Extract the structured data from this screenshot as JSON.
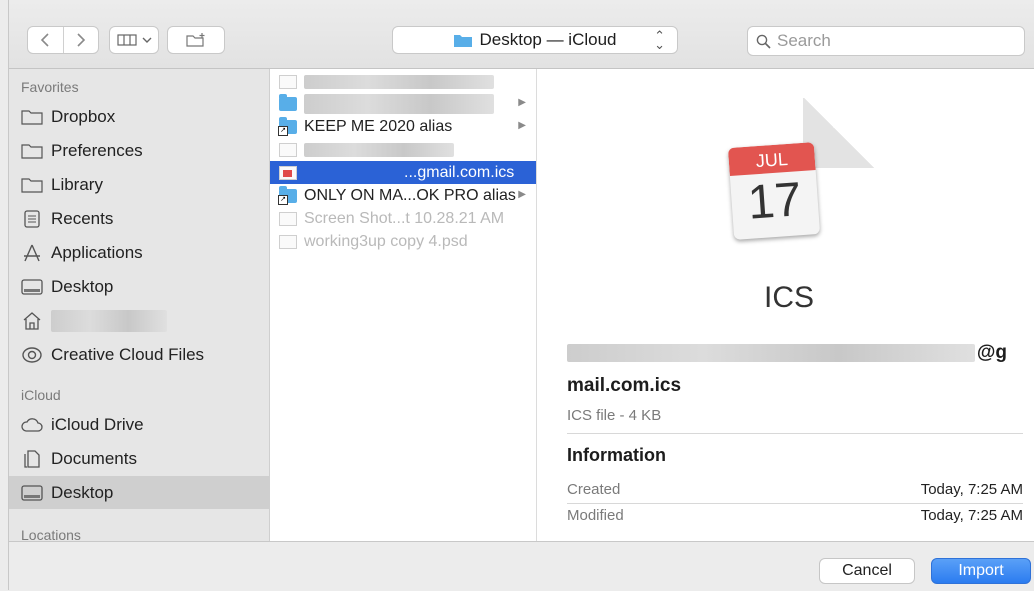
{
  "toolbar": {
    "back_icon": "chevron-left-icon",
    "forward_icon": "chevron-right-icon",
    "view_icon": "columns-view-icon",
    "new_folder_icon": "new-folder-icon",
    "location": "Desktop — iCloud",
    "search_placeholder": "Search"
  },
  "sidebar": {
    "favorites_heading": "Favorites",
    "favorites": [
      {
        "label": "Dropbox",
        "icon": "folder-icon"
      },
      {
        "label": "Preferences",
        "icon": "folder-icon"
      },
      {
        "label": "Library",
        "icon": "folder-icon"
      },
      {
        "label": "Recents",
        "icon": "recents-icon"
      },
      {
        "label": "Applications",
        "icon": "applications-icon"
      },
      {
        "label": "Desktop",
        "icon": "desktop-icon"
      },
      {
        "label": "",
        "icon": "home-icon"
      },
      {
        "label": "Creative Cloud Files",
        "icon": "creative-cloud-icon"
      }
    ],
    "icloud_heading": "iCloud",
    "icloud": [
      {
        "label": "iCloud Drive",
        "icon": "cloud-icon"
      },
      {
        "label": "Documents",
        "icon": "documents-icon"
      },
      {
        "label": "Desktop",
        "icon": "desktop-icon",
        "selected": true
      }
    ],
    "locations_heading": "Locations"
  },
  "files": [
    {
      "name": "",
      "icon": "document-icon",
      "blurred": true
    },
    {
      "name": "",
      "icon": "folder-icon",
      "blurred": true,
      "has_children": true
    },
    {
      "name": "KEEP ME 2020 alias",
      "icon": "folder-alias-icon",
      "has_children": true
    },
    {
      "name": "",
      "icon": "document-icon",
      "blurred": true
    },
    {
      "name": "...gmail.com.ics",
      "icon": "ics-file-icon",
      "selected": true
    },
    {
      "name": "ONLY ON MA...OK PRO alias",
      "icon": "folder-alias-icon",
      "has_children": true
    },
    {
      "name": "Screen Shot...t 10.28.21 AM",
      "icon": "image-file-icon",
      "disabled": true
    },
    {
      "name": "working3up copy 4.psd",
      "icon": "psd-file-icon",
      "disabled": true
    }
  ],
  "preview": {
    "calendar_month": "JUL",
    "calendar_day": "17",
    "file_type_label": "ICS",
    "name_tail": "@g",
    "name_line2": "mail.com.ics",
    "kind": "ICS file - 4 KB",
    "info_heading": "Information",
    "info": [
      {
        "key": "Created",
        "value": "Today, 7:25 AM"
      },
      {
        "key": "Modified",
        "value": "Today, 7:25 AM"
      }
    ]
  },
  "footer": {
    "cancel_label": "Cancel",
    "import_label": "Import"
  },
  "colors": {
    "accent": "#2b7cf0",
    "selection": "#2b62d6",
    "folder": "#58aee8"
  }
}
